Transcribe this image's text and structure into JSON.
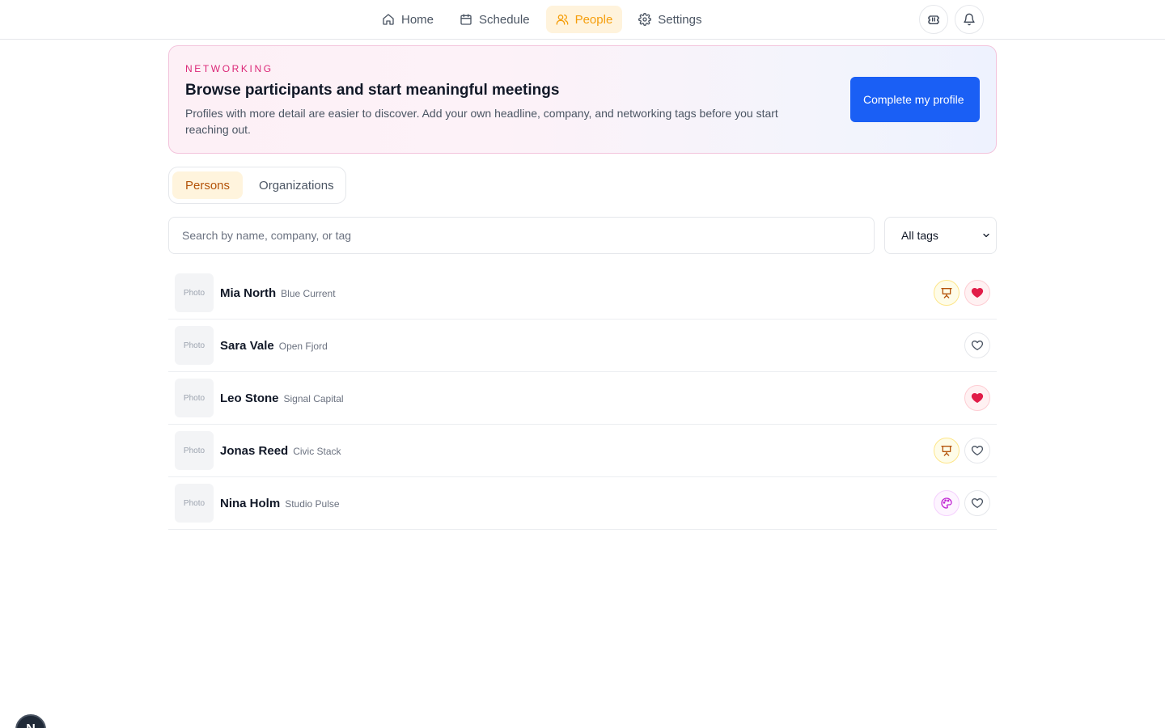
{
  "nav": {
    "items": [
      {
        "label": "Home",
        "icon": "home-icon"
      },
      {
        "label": "Schedule",
        "icon": "calendar-icon"
      },
      {
        "label": "People",
        "icon": "users-icon",
        "active": true
      },
      {
        "label": "Settings",
        "icon": "gear-icon"
      }
    ],
    "active_color": "#f59e0b"
  },
  "banner": {
    "eyebrow": "NETWORKING",
    "title": "Browse participants and start meaningful meetings",
    "description": "Profiles with more detail are easier to discover. Add your own headline, company, and networking tags before you start reaching out.",
    "cta_label": "Complete my profile"
  },
  "tabs": [
    {
      "label": "Persons",
      "active": true
    },
    {
      "label": "Organizations",
      "active": false
    }
  ],
  "search": {
    "placeholder": "Search by name, company, or tag",
    "value": ""
  },
  "tag_filter": {
    "selected": "All tags"
  },
  "people": [
    {
      "photo": "Photo",
      "name": "Mia North",
      "company": "Blue Current",
      "badge": "speaker",
      "favorite": true
    },
    {
      "photo": "Photo",
      "name": "Sara Vale",
      "company": "Open Fjord",
      "badge": null,
      "favorite": false
    },
    {
      "photo": "Photo",
      "name": "Leo Stone",
      "company": "Signal Capital",
      "badge": null,
      "favorite": true
    },
    {
      "photo": "Photo",
      "name": "Jonas Reed",
      "company": "Civic Stack",
      "badge": "speaker",
      "favorite": false
    },
    {
      "photo": "Photo",
      "name": "Nina Holm",
      "company": "Studio Pulse",
      "badge": "creative",
      "favorite": false
    }
  ],
  "colors": {
    "primary": "#1a5ff5",
    "accent_pink": "#db2777",
    "favorite": "#e11d48"
  },
  "dev_badge": "N"
}
